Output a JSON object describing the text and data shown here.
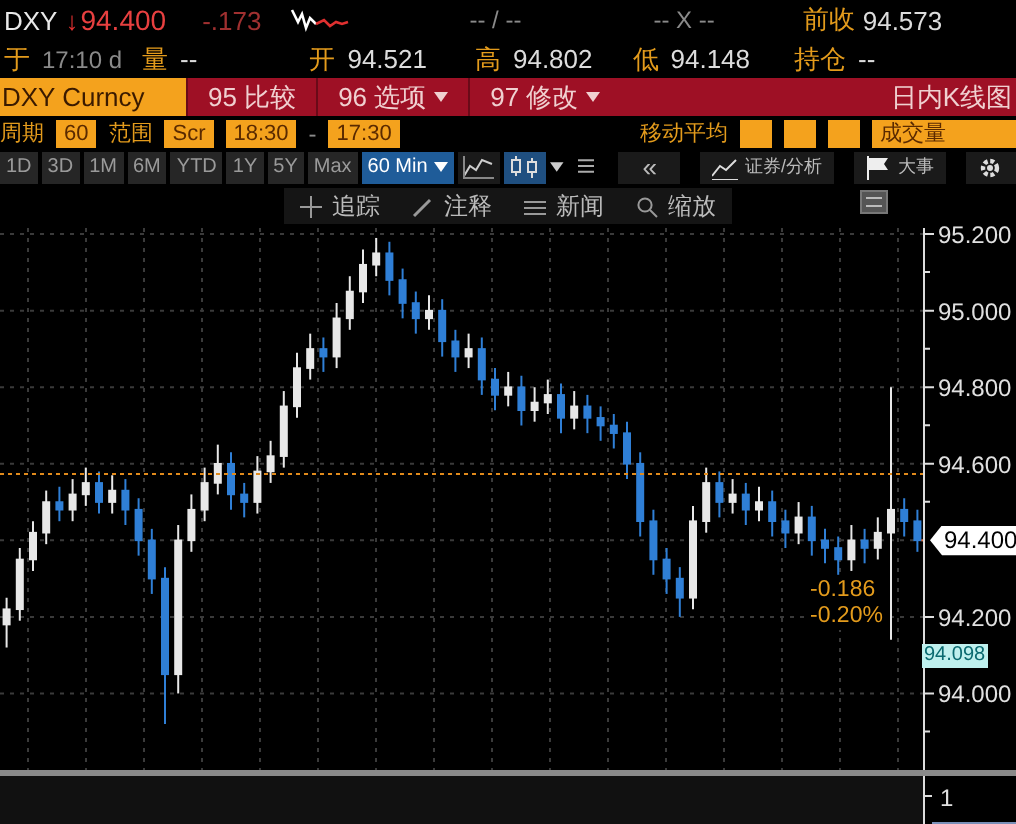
{
  "quote": {
    "ticker": "DXY",
    "arrow": "↓",
    "last": "94.400",
    "change": "-.173",
    "bid_ask": "-- / --",
    "size": "-- X --",
    "prev_close_label": "前收",
    "prev_close": "94.573"
  },
  "stats": [
    {
      "label": "于",
      "value": "17:10 d"
    },
    {
      "label": "量",
      "value": "--"
    },
    {
      "label": "开",
      "value": "94.521"
    },
    {
      "label": "高",
      "value": "94.802"
    },
    {
      "label": "低",
      "value": "94.148"
    },
    {
      "label": "持仓",
      "value": "--"
    }
  ],
  "command_bar": {
    "security": "DXY Curncy",
    "menus": [
      {
        "number": "95",
        "label": "比较",
        "dropdown": false
      },
      {
        "number": "96",
        "label": "选项",
        "dropdown": true
      },
      {
        "number": "97",
        "label": "修改",
        "dropdown": true
      }
    ],
    "title": "日内K线图"
  },
  "settings": {
    "period_label": "周期",
    "period": "60",
    "range_label": "范围",
    "range_mode": "Scr",
    "start": "18:30",
    "separator": "-",
    "end": "17:30",
    "ma_label": "移动平均",
    "volume": "成交量"
  },
  "ranges": [
    {
      "label": "1D",
      "selected": false
    },
    {
      "label": "3D",
      "selected": false
    },
    {
      "label": "1M",
      "selected": false
    },
    {
      "label": "6M",
      "selected": false
    },
    {
      "label": "YTD",
      "selected": false
    },
    {
      "label": "1Y",
      "selected": false
    },
    {
      "label": "5Y",
      "selected": false
    },
    {
      "label": "Max",
      "selected": false
    }
  ],
  "interval": {
    "label": "60 Min",
    "selected": true
  },
  "chart_types": [
    {
      "kind": "line",
      "selected": false
    },
    {
      "kind": "candle",
      "selected": true
    }
  ],
  "right_tools": [
    {
      "kind": "back",
      "label": "«"
    },
    {
      "kind": "analysis",
      "label": "证券/分析"
    },
    {
      "kind": "events",
      "label": "大事"
    },
    {
      "kind": "settings"
    }
  ],
  "chart_toolbar": [
    {
      "kind": "crosshair",
      "label": "追踪"
    },
    {
      "kind": "annotate",
      "label": "注释"
    },
    {
      "kind": "news",
      "label": "新闻"
    },
    {
      "kind": "zoom",
      "label": "缩放"
    }
  ],
  "chart": {
    "last_price": "94.400",
    "change": "-0.186",
    "change_pct": "-0.20%",
    "low_marker": "94.098",
    "lower_panel_tick": "1",
    "chart_data": {
      "type": "candlestick",
      "grid": true,
      "ref_lines": [
        {
          "axis": "y",
          "value": 94.573
        }
      ],
      "ylim": [
        93.8,
        95.216
      ],
      "categories": [
        null,
        null,
        null,
        null,
        null,
        null,
        null,
        null,
        null,
        null,
        null,
        null,
        null,
        null,
        null,
        null,
        null,
        null,
        null,
        null,
        null,
        null,
        null,
        null,
        null,
        null,
        null,
        null,
        null,
        null,
        null,
        null,
        null,
        null,
        null,
        null,
        null,
        null,
        null,
        null,
        null,
        null,
        null,
        null,
        null,
        null,
        null,
        null,
        null,
        null,
        null,
        null,
        null,
        null,
        null,
        null,
        null,
        null,
        null,
        null,
        null,
        null,
        null,
        null,
        null,
        null,
        null,
        null,
        null,
        null
      ],
      "yticks": [
        {
          "value": 95.2,
          "label": "95.200"
        },
        {
          "value": 95.0,
          "label": "95.000"
        },
        {
          "value": 94.8,
          "label": "94.800"
        },
        {
          "value": 94.6,
          "label": "94.600"
        },
        {
          "value": 94.2,
          "label": "94.200"
        },
        {
          "value": 94.0,
          "label": "94.000"
        }
      ],
      "ohlc": [
        [
          94.18,
          94.25,
          94.12,
          94.22
        ],
        [
          94.22,
          94.38,
          94.19,
          94.35
        ],
        [
          94.35,
          94.45,
          94.32,
          94.42
        ],
        [
          94.42,
          94.53,
          94.39,
          94.5
        ],
        [
          94.5,
          94.54,
          94.45,
          94.48
        ],
        [
          94.48,
          94.56,
          94.45,
          94.52
        ],
        [
          94.52,
          94.59,
          94.49,
          94.55
        ],
        [
          94.55,
          94.58,
          94.47,
          94.5
        ],
        [
          94.5,
          94.57,
          94.47,
          94.53
        ],
        [
          94.53,
          94.56,
          94.44,
          94.48
        ],
        [
          94.48,
          94.51,
          94.36,
          94.4
        ],
        [
          94.4,
          94.43,
          94.26,
          94.3
        ],
        [
          94.3,
          94.33,
          93.92,
          94.05
        ],
        [
          94.05,
          94.44,
          94.0,
          94.4
        ],
        [
          94.4,
          94.52,
          94.37,
          94.48
        ],
        [
          94.48,
          94.59,
          94.45,
          94.55
        ],
        [
          94.55,
          94.65,
          94.52,
          94.6
        ],
        [
          94.6,
          94.63,
          94.48,
          94.52
        ],
        [
          94.52,
          94.55,
          94.46,
          94.5
        ],
        [
          94.5,
          94.62,
          94.47,
          94.58
        ],
        [
          94.58,
          94.66,
          94.55,
          94.62
        ],
        [
          94.62,
          94.79,
          94.59,
          94.75
        ],
        [
          94.75,
          94.89,
          94.72,
          94.85
        ],
        [
          94.85,
          94.94,
          94.82,
          94.9
        ],
        [
          94.9,
          94.93,
          94.84,
          94.88
        ],
        [
          94.88,
          95.02,
          94.85,
          94.98
        ],
        [
          94.98,
          95.09,
          94.95,
          95.05
        ],
        [
          95.05,
          95.16,
          95.02,
          95.12
        ],
        [
          95.12,
          95.19,
          95.09,
          95.15
        ],
        [
          95.15,
          95.18,
          95.04,
          95.08
        ],
        [
          95.08,
          95.11,
          94.98,
          95.02
        ],
        [
          95.02,
          95.05,
          94.94,
          94.98
        ],
        [
          94.98,
          95.04,
          94.95,
          95.0
        ],
        [
          95.0,
          95.03,
          94.88,
          94.92
        ],
        [
          94.92,
          94.95,
          94.84,
          94.88
        ],
        [
          94.88,
          94.94,
          94.85,
          94.9
        ],
        [
          94.9,
          94.93,
          94.78,
          94.82
        ],
        [
          94.82,
          94.85,
          94.74,
          94.78
        ],
        [
          94.78,
          94.84,
          94.75,
          94.8
        ],
        [
          94.8,
          94.83,
          94.7,
          94.74
        ],
        [
          94.74,
          94.8,
          94.71,
          94.76
        ],
        [
          94.76,
          94.82,
          94.73,
          94.78
        ],
        [
          94.78,
          94.81,
          94.68,
          94.72
        ],
        [
          94.72,
          94.79,
          94.69,
          94.75
        ],
        [
          94.75,
          94.78,
          94.68,
          94.72
        ],
        [
          94.72,
          94.75,
          94.66,
          94.7
        ],
        [
          94.7,
          94.73,
          94.64,
          94.68
        ],
        [
          94.68,
          94.71,
          94.56,
          94.6
        ],
        [
          94.6,
          94.63,
          94.41,
          94.45
        ],
        [
          94.45,
          94.48,
          94.31,
          94.35
        ],
        [
          94.35,
          94.38,
          94.26,
          94.3
        ],
        [
          94.3,
          94.33,
          94.2,
          94.25
        ],
        [
          94.25,
          94.49,
          94.22,
          94.45
        ],
        [
          94.45,
          94.59,
          94.42,
          94.55
        ],
        [
          94.55,
          94.58,
          94.46,
          94.5
        ],
        [
          94.5,
          94.56,
          94.47,
          94.52
        ],
        [
          94.52,
          94.55,
          94.44,
          94.48
        ],
        [
          94.48,
          94.54,
          94.45,
          94.5
        ],
        [
          94.5,
          94.53,
          94.41,
          94.45
        ],
        [
          94.45,
          94.48,
          94.38,
          94.42
        ],
        [
          94.42,
          94.5,
          94.39,
          94.46
        ],
        [
          94.46,
          94.49,
          94.36,
          94.4
        ],
        [
          94.4,
          94.43,
          94.34,
          94.38
        ],
        [
          94.38,
          94.41,
          94.31,
          94.35
        ],
        [
          94.35,
          94.44,
          94.32,
          94.4
        ],
        [
          94.4,
          94.43,
          94.34,
          94.38
        ],
        [
          94.38,
          94.46,
          94.35,
          94.42
        ],
        [
          94.42,
          94.8,
          94.14,
          94.48
        ],
        [
          94.48,
          94.51,
          94.41,
          94.45
        ],
        [
          94.45,
          94.48,
          94.37,
          94.4
        ]
      ]
    }
  }
}
